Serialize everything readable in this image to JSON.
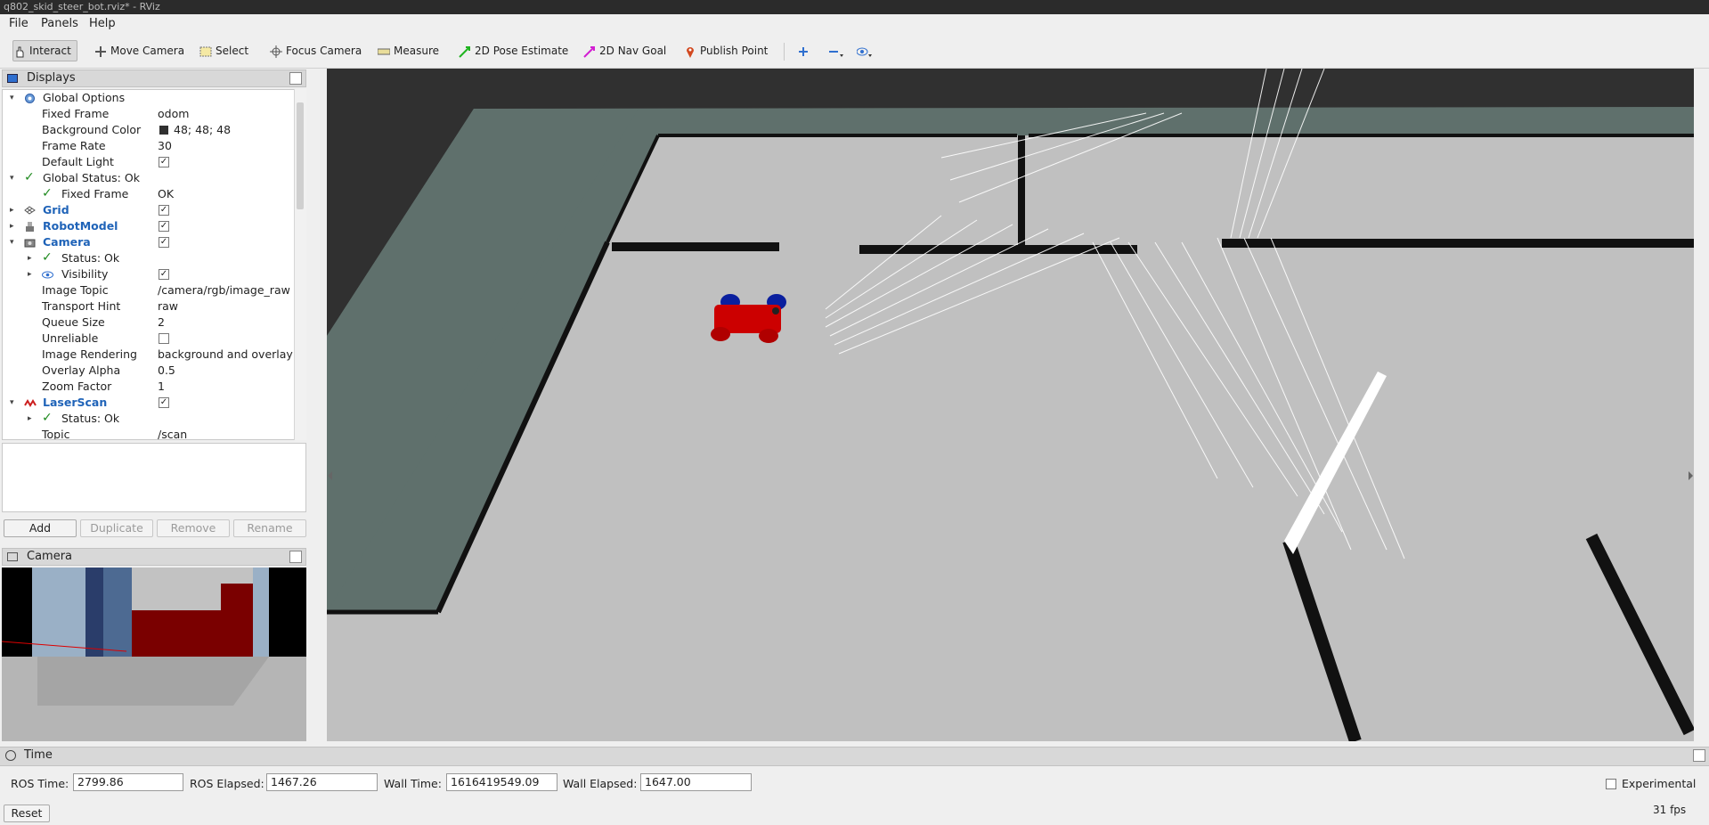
{
  "window": {
    "title": "q802_skid_steer_bot.rviz* - RViz"
  },
  "menu": {
    "file": "File",
    "panels": "Panels",
    "help": "Help"
  },
  "toolbar": {
    "interact": "Interact",
    "move_camera": "Move Camera",
    "select": "Select",
    "focus_camera": "Focus Camera",
    "measure": "Measure",
    "pose_estimate": "2D Pose Estimate",
    "nav_goal": "2D Nav Goal",
    "publish_point": "Publish Point",
    "icons": [
      "plus-icon",
      "minus-icon",
      "eye-icon"
    ]
  },
  "displays": {
    "title": "Displays",
    "global_options": "Global Options",
    "fixed_frame_label": "Fixed Frame",
    "fixed_frame_value": "odom",
    "bg_color_label": "Background Color",
    "bg_color_value": "48; 48; 48",
    "frame_rate_label": "Frame Rate",
    "frame_rate_value": "30",
    "default_light_label": "Default Light",
    "global_status": "Global Status: Ok",
    "status_fixed_frame_label": "Fixed Frame",
    "status_fixed_frame_value": "OK",
    "grid": "Grid",
    "robot_model": "RobotModel",
    "camera": "Camera",
    "camera_status": "Status: Ok",
    "visibility": "Visibility",
    "image_topic_label": "Image Topic",
    "image_topic_value": "/camera/rgb/image_raw",
    "transport_hint_label": "Transport Hint",
    "transport_hint_value": "raw",
    "queue_size_label": "Queue Size",
    "queue_size_value": "2",
    "unreliable_label": "Unreliable",
    "image_rendering_label": "Image Rendering",
    "image_rendering_value": "background and overlay",
    "overlay_alpha_label": "Overlay Alpha",
    "overlay_alpha_value": "0.5",
    "zoom_factor_label": "Zoom Factor",
    "zoom_factor_value": "1",
    "laser_scan": "LaserScan",
    "laser_status": "Status: Ok",
    "topic_label": "Topic",
    "topic_value": "/scan"
  },
  "buttons": {
    "add": "Add",
    "duplicate": "Duplicate",
    "remove": "Remove",
    "rename": "Rename"
  },
  "camera_panel": {
    "title": "Camera"
  },
  "time": {
    "title": "Time",
    "ros_time_label": "ROS Time:",
    "ros_time": "2799.86",
    "ros_elapsed_label": "ROS Elapsed:",
    "ros_elapsed": "1467.26",
    "wall_time_label": "Wall Time:",
    "wall_time": "1616419549.09",
    "wall_elapsed_label": "Wall Elapsed:",
    "wall_elapsed": "1647.00",
    "experimental": "Experimental",
    "reset": "Reset",
    "fps": "31 fps"
  },
  "colors": {
    "background": "#303030",
    "floor": "#c0c0c0",
    "robot": "#cc0000",
    "wheels": "#0a1f9e"
  }
}
